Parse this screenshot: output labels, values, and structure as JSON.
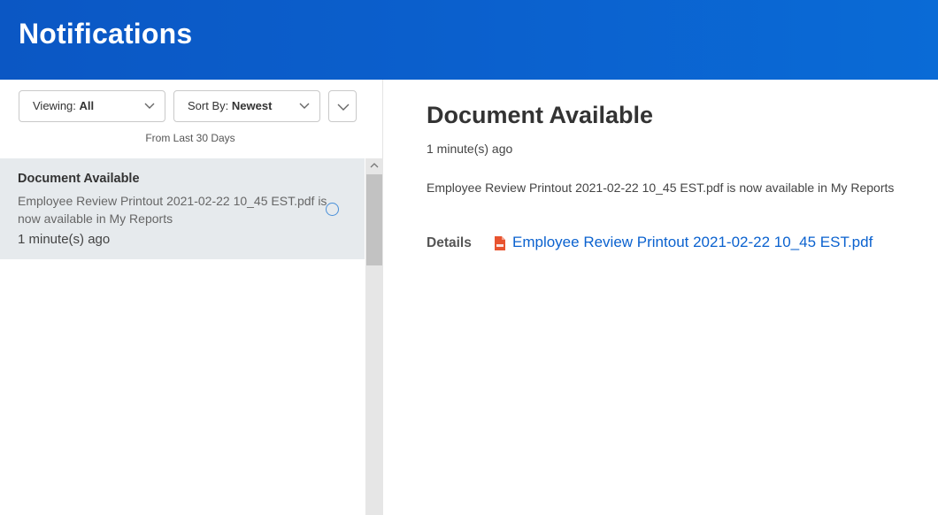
{
  "header": {
    "title": "Notifications",
    "background": "#0b62cf"
  },
  "filters": {
    "viewing_label": "Viewing:",
    "viewing_value": "All",
    "sort_label": "Sort By:",
    "sort_value": "Newest",
    "range_text": "From Last 30 Days"
  },
  "list": {
    "items": [
      {
        "title": "Document Available",
        "description": "Employee Review Printout 2021-02-22 10_45 EST.pdf is now available in My Reports",
        "time": "1 minute(s) ago",
        "selected": true
      }
    ]
  },
  "detail": {
    "title": "Document Available",
    "time": "1 minute(s) ago",
    "description": "Employee Review Printout 2021-02-22 10_45 EST.pdf is now available in My Reports",
    "details_label": "Details",
    "file_name": "Employee Review Printout 2021-02-22 10_45 EST.pdf",
    "file_icon": "pdf-file-icon",
    "link_color": "#0b62cf"
  }
}
